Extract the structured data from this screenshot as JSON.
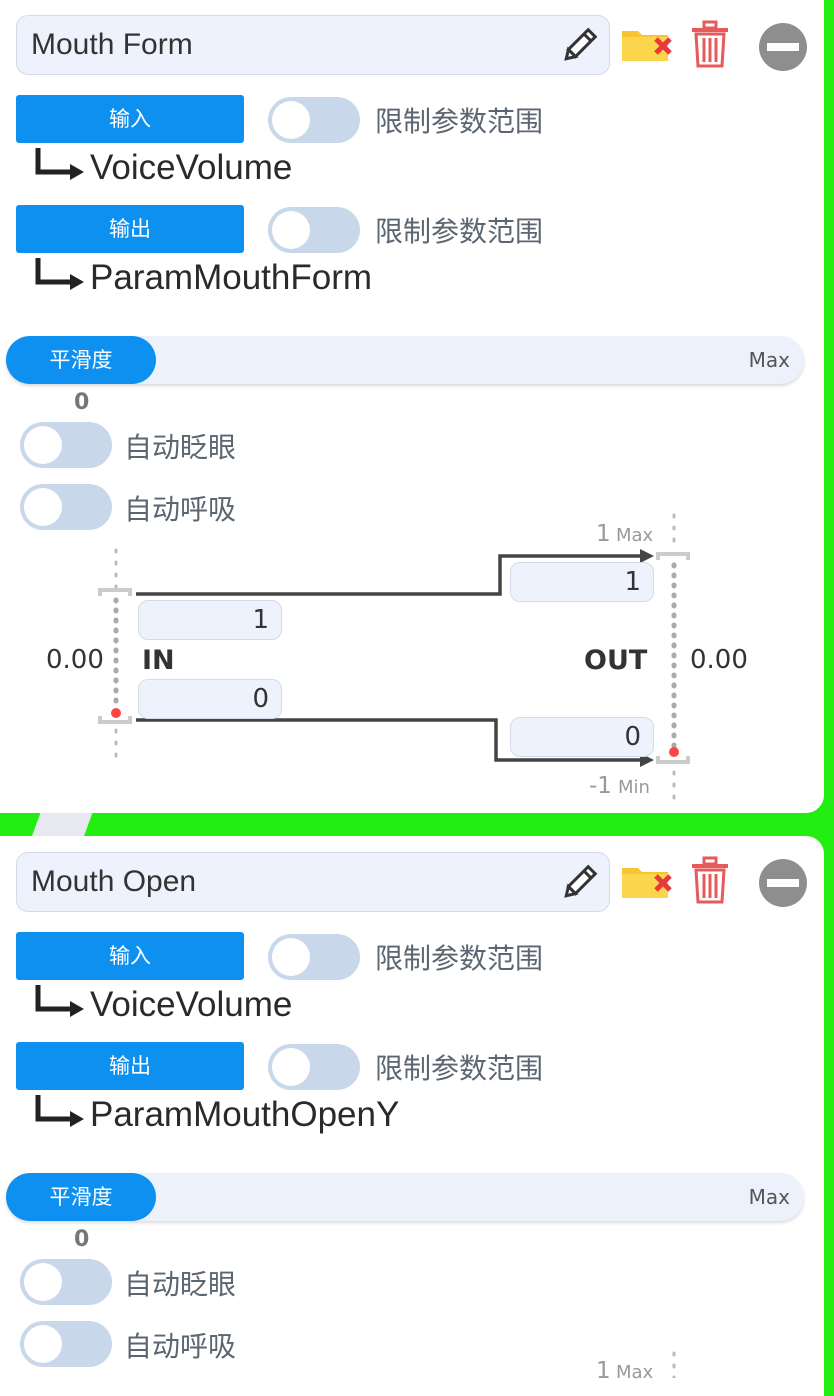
{
  "cards": [
    {
      "name": "Mouth Form",
      "input_button": "输入",
      "input_limit_label": "限制参数范围",
      "input_param": "VoiceVolume",
      "output_button": "输出",
      "output_limit_label": "限制参数范围",
      "output_param": "ParamMouthForm",
      "smoothing_label": "平滑度",
      "smoothing_max": "Max",
      "smoothing_value": "0",
      "auto_blink_label": "自动眨眼",
      "auto_breath_label": "自动呼吸",
      "graph": {
        "in_value": "0.00",
        "in_label": "IN",
        "in_max": "1",
        "in_min": "0",
        "out_value": "0.00",
        "out_label": "OUT",
        "out_max_num": "1",
        "out_max_text": "Max",
        "out_min_num": "-1",
        "out_min_text": "Min",
        "out_max_box": "1",
        "out_min_box": "0"
      }
    },
    {
      "name": "Mouth Open",
      "input_button": "输入",
      "input_limit_label": "限制参数范围",
      "input_param": "VoiceVolume",
      "output_button": "输出",
      "output_limit_label": "限制参数范围",
      "output_param": "ParamMouthOpenY",
      "smoothing_label": "平滑度",
      "smoothing_max": "Max",
      "smoothing_value": "0",
      "auto_blink_label": "自动眨眼",
      "auto_breath_label": "自动呼吸",
      "graph": {
        "out_max_num": "1",
        "out_max_text": "Max"
      }
    }
  ],
  "colors": {
    "background": "#22ee11",
    "accent": "#0e90f0",
    "toggle_off": "#c8d8ea",
    "delete_red": "#e85a5a",
    "folder_yellow": "#f6c531",
    "indicator_red": "#ff4444"
  },
  "icons": [
    "pencil-icon",
    "folder-remove-icon",
    "trash-icon",
    "minus-circle-icon",
    "arrow-elbow-icon"
  ]
}
